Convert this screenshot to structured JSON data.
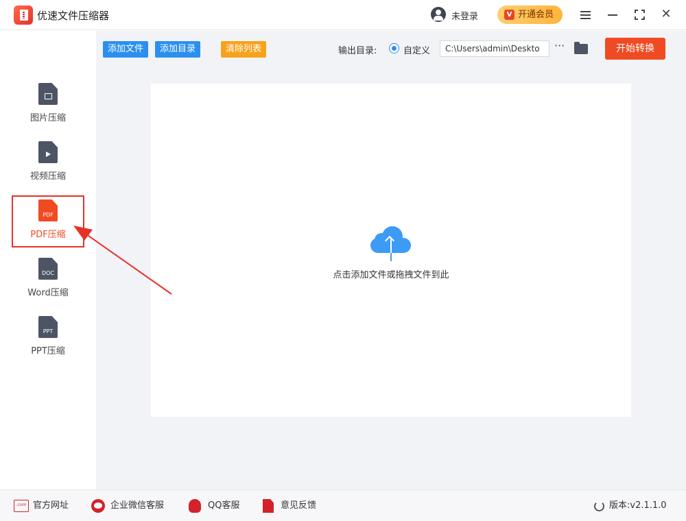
{
  "app": {
    "title": "优速文件压缩器"
  },
  "header": {
    "login_text": "未登录",
    "vip_label": "开通会员",
    "vip_badge": "V"
  },
  "sidebar": {
    "items": [
      {
        "label": "图片压缩",
        "icon": "image-file-icon",
        "tag": ""
      },
      {
        "label": "视频压缩",
        "icon": "video-file-icon",
        "tag": ""
      },
      {
        "label": "PDF压缩",
        "icon": "pdf-file-icon",
        "tag": "PDF",
        "active": true
      },
      {
        "label": "Word压缩",
        "icon": "doc-file-icon",
        "tag": "DOC"
      },
      {
        "label": "PPT压缩",
        "icon": "ppt-file-icon",
        "tag": "PPT"
      }
    ]
  },
  "toolbar": {
    "add_file": "添加文件",
    "add_dir": "添加目录",
    "clear_list": "清除列表",
    "output_label": "输出目录:",
    "custom_option": "自定义",
    "output_path": "C:\\Users\\admin\\Deskto",
    "more": "···",
    "start": "开始转换"
  },
  "dropzone": {
    "hint": "点击添加文件或拖拽文件到此"
  },
  "footer": {
    "website": "官方网址",
    "website_icon_text": ".com",
    "wechat": "企业微信客服",
    "qq": "QQ客服",
    "feedback": "意见反馈",
    "version": "版本:v2.1.1.0"
  },
  "colors": {
    "primary": "#2b8ff0",
    "accent": "#f04a22",
    "warning": "#f7a21b",
    "annotation": "#e8302a"
  }
}
